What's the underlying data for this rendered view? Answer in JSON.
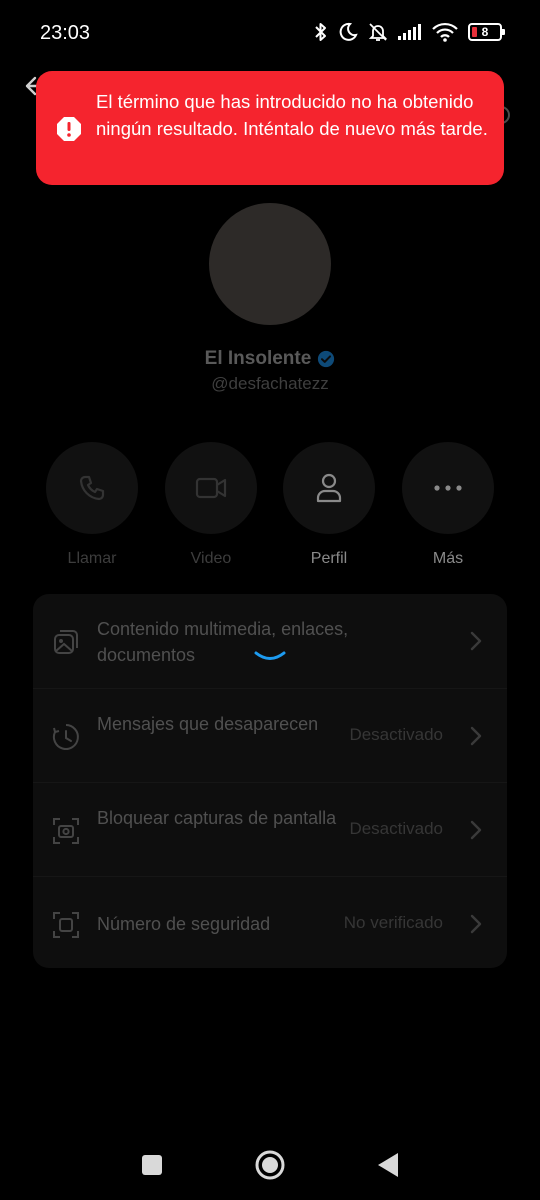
{
  "status_bar": {
    "time": "23:03",
    "battery_level": "8",
    "icons": [
      "bluetooth-icon",
      "do-not-disturb-icon",
      "muted-bell-icon",
      "signal-icon",
      "wifi-icon",
      "battery-icon"
    ]
  },
  "toast": {
    "icon": "alert-icon",
    "message": "El término que has introducido no ha obtenido ningún resultado. Inténtalo de nuevo más tarde.",
    "color": "#f5242e"
  },
  "profile": {
    "name": "El Insolente",
    "handle": "@desfachatezz"
  },
  "actions": [
    {
      "label": "Llamar",
      "icon": "phone-icon"
    },
    {
      "label": "Video",
      "icon": "video-icon"
    },
    {
      "label": "Perfil",
      "icon": "person-icon"
    },
    {
      "label": "Más",
      "icon": "more-icon"
    }
  ],
  "settings": [
    {
      "title": "Contenido multimedia, enlaces, documentos",
      "value": "",
      "icon": "media-icon"
    },
    {
      "title": "Mensajes que desaparecen",
      "value": "Desactivado",
      "icon": "timer-icon"
    },
    {
      "title": "Bloquear capturas de pantalla",
      "value": "Desactivado",
      "icon": "screenshot-block-icon"
    },
    {
      "title": "Número de seguridad",
      "value": "No verificado",
      "icon": "security-number-icon"
    }
  ],
  "colors": {
    "accent": "#1d9bf0",
    "toast_bg": "#f5242e",
    "background": "#000000"
  }
}
